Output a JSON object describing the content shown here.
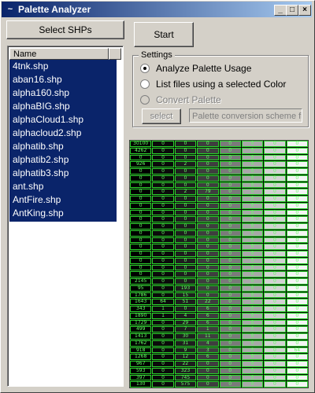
{
  "window": {
    "title": "Palette Analyzer"
  },
  "buttons": {
    "select_shps": "Select SHPs",
    "start": "Start",
    "select": "select"
  },
  "list": {
    "header": "Name",
    "items": [
      "4tnk.shp",
      "aban16.shp",
      "alpha160.shp",
      "alphaBIG.shp",
      "alphaCloud1.shp",
      "alphacloud2.shp",
      "alphatib.shp",
      "alphatib2.shp",
      "alphatib3.shp",
      "ant.shp",
      "AntFire.shp",
      "AntKing.shp"
    ]
  },
  "settings": {
    "label": "Settings",
    "options": [
      {
        "label": "Analyze Palette Usage",
        "checked": true,
        "enabled": true
      },
      {
        "label": "List files using a selected Color",
        "checked": false,
        "enabled": true
      },
      {
        "label": "Convert Palette",
        "checked": false,
        "enabled": false
      }
    ],
    "scheme_field": "Palette conversion scheme fil"
  },
  "grid": {
    "rows": [
      [
        "30100",
        "0",
        "0",
        "0",
        "0",
        "0",
        "0",
        "0"
      ],
      [
        "4262",
        "0",
        "0",
        "0",
        "0",
        "0",
        "0",
        "0"
      ],
      [
        "0",
        "0",
        "0",
        "0",
        "0",
        "0",
        "0",
        "0"
      ],
      [
        "926",
        "0",
        "2",
        "0",
        "0",
        "0",
        "0",
        "0"
      ],
      [
        "0",
        "0",
        "0",
        "0",
        "0",
        "0",
        "0",
        "0"
      ],
      [
        "0",
        "0",
        "0",
        "0",
        "0",
        "0",
        "0",
        "0"
      ],
      [
        "0",
        "0",
        "0",
        "0",
        "0",
        "0",
        "0",
        "0"
      ],
      [
        "0",
        "0",
        "2",
        "79",
        "0",
        "0",
        "0",
        "0"
      ],
      [
        "0",
        "0",
        "0",
        "0",
        "0",
        "0",
        "0",
        "0"
      ],
      [
        "0",
        "0",
        "0",
        "0",
        "0",
        "0",
        "0",
        "0"
      ],
      [
        "0",
        "0",
        "0",
        "0",
        "0",
        "0",
        "0",
        "0"
      ],
      [
        "0",
        "0",
        "0",
        "0",
        "0",
        "0",
        "0",
        "0"
      ],
      [
        "0",
        "0",
        "0",
        "0",
        "0",
        "0",
        "0",
        "0"
      ],
      [
        "0",
        "0",
        "0",
        "0",
        "0",
        "0",
        "0",
        "0"
      ],
      [
        "0",
        "0",
        "0",
        "0",
        "0",
        "0",
        "0",
        "0"
      ],
      [
        "0",
        "0",
        "0",
        "0",
        "0",
        "0",
        "0",
        "0"
      ],
      [
        "0",
        "0",
        "0",
        "0",
        "0",
        "0",
        "0",
        "0"
      ],
      [
        "0",
        "0",
        "0",
        "0",
        "0",
        "0",
        "0",
        "0"
      ],
      [
        "0",
        "0",
        "0",
        "0",
        "0",
        "0",
        "0",
        "0"
      ],
      [
        "0",
        "0",
        "0",
        "0",
        "0",
        "0",
        "0",
        "0"
      ],
      [
        "2145",
        "0",
        "0",
        "0",
        "0",
        "0",
        "0",
        "0"
      ],
      [
        "95",
        "0",
        "193",
        "0",
        "0",
        "0",
        "0",
        "0"
      ],
      [
        "1786",
        "0",
        "15",
        "0",
        "0",
        "0",
        "0",
        "0"
      ],
      [
        "1643",
        "64",
        "51",
        "22",
        "0",
        "0",
        "0",
        "0"
      ],
      [
        "343",
        "1",
        "0",
        "6",
        "0",
        "0",
        "0",
        "0"
      ],
      [
        "1890",
        "1",
        "4",
        "6",
        "0",
        "0",
        "0",
        "0"
      ],
      [
        "1729",
        "0",
        "29",
        "6",
        "0",
        "0",
        "0",
        "0"
      ],
      [
        "499",
        "0",
        "7",
        "1",
        "0",
        "0",
        "0",
        "0"
      ],
      [
        "1413",
        "0",
        "30",
        "11",
        "0",
        "0",
        "0",
        "0"
      ],
      [
        "1762",
        "0",
        "31",
        "4",
        "0",
        "0",
        "0",
        "0"
      ],
      [
        "918",
        "0",
        "9",
        "3",
        "0",
        "0",
        "0",
        "64"
      ],
      [
        "1268",
        "0",
        "12",
        "6",
        "0",
        "0",
        "0",
        "0"
      ],
      [
        "967",
        "0",
        "22",
        "0",
        "0",
        "0",
        "0",
        "0"
      ],
      [
        "593",
        "0",
        "323",
        "0",
        "0",
        "0",
        "0",
        "0"
      ],
      [
        "397",
        "0",
        "745",
        "0",
        "0",
        "0",
        "0",
        "0"
      ],
      [
        "130",
        "0",
        "575",
        "0",
        "0",
        "0",
        "0",
        "0"
      ]
    ]
  }
}
